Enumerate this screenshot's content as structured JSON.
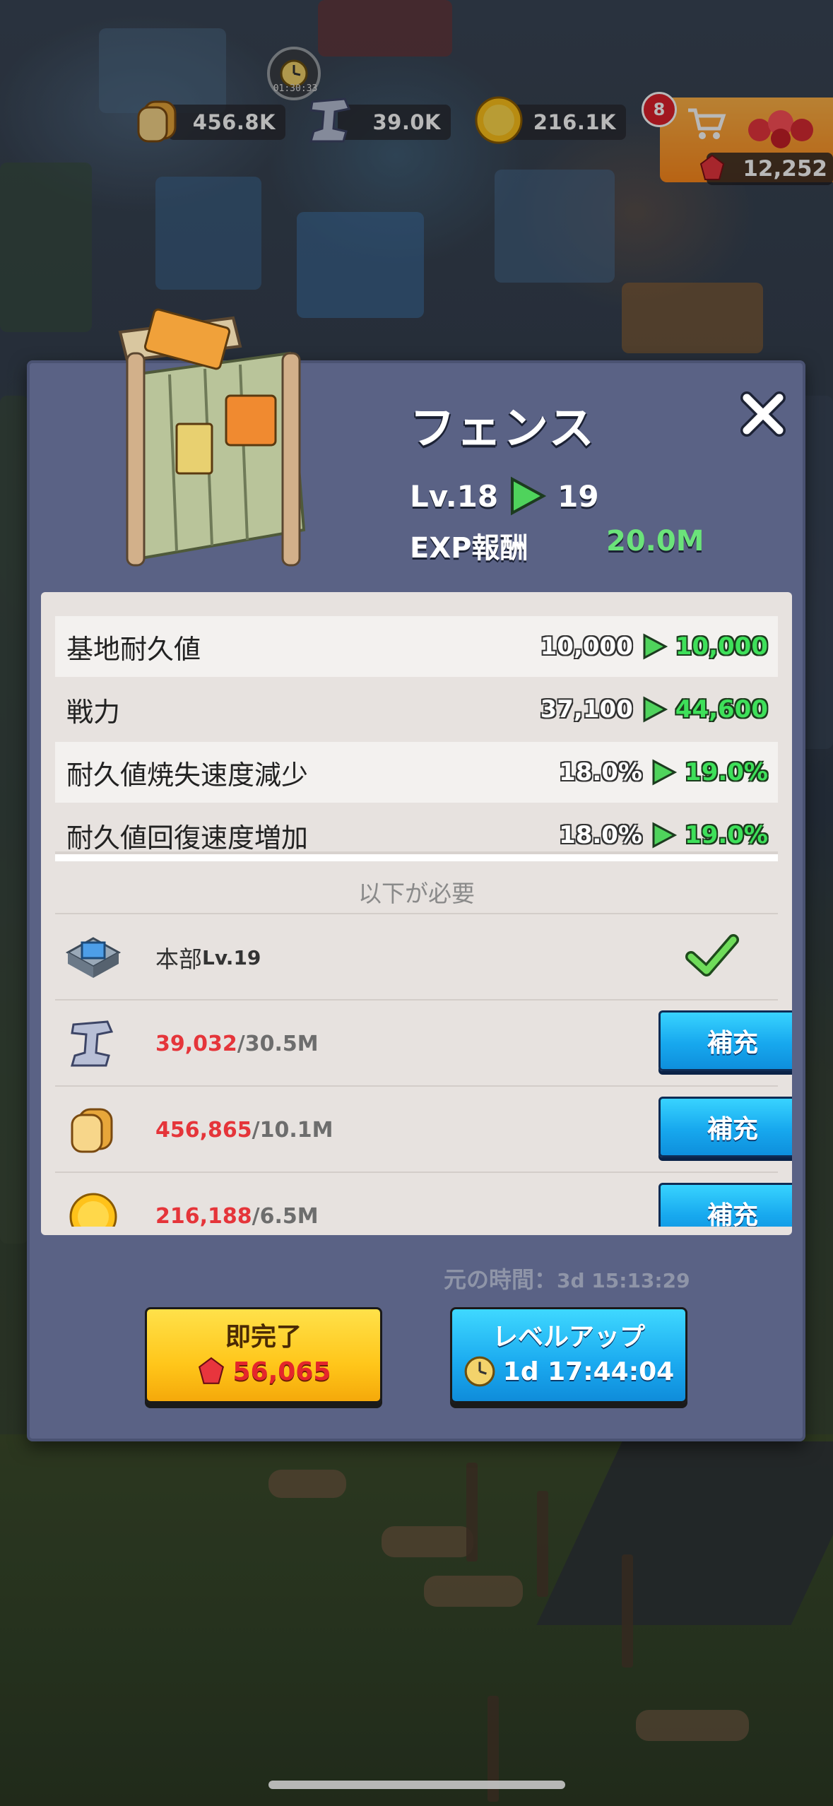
{
  "resources": {
    "food": "456.8K",
    "iron": "39.0K",
    "gold": "216.1K"
  },
  "timer_label": "01:30:33",
  "shop": {
    "badge": "8",
    "gems": "12,252"
  },
  "modal": {
    "title": "フェンス",
    "level_prefix": "Lv.18",
    "level_next": "19",
    "exp_label": "EXP報酬",
    "exp_value": "20.0M",
    "stats": [
      {
        "label": "基地耐久値",
        "old": "10,000",
        "new": "10,000"
      },
      {
        "label": "戦力",
        "old": "37,100",
        "new": "44,600"
      },
      {
        "label": "耐久値焼失速度減少",
        "old": "18.0%",
        "new": "19.0%"
      },
      {
        "label": "耐久値回復速度増加",
        "old": "18.0%",
        "new": "19.0%"
      }
    ],
    "requirements_title": "以下が必要",
    "requirements": [
      {
        "label": "本部",
        "level": "Lv.19"
      },
      {
        "have": "39,032",
        "need": "/30.5M",
        "button": "補充"
      },
      {
        "have": "456,865",
        "need": "/10.1M",
        "button": "補充"
      },
      {
        "have": "216,188",
        "need": "/6.5M",
        "button": "補充"
      }
    ],
    "original_time_label": "元の時間：",
    "original_time_value": "3d 15:13:29",
    "instant_label": "即完了",
    "instant_cost": "56,065",
    "levelup_label": "レベルアップ",
    "levelup_time": "1d 17:44:04"
  },
  "colors": {
    "modal_bg": "#5a6285",
    "accent_green": "#3ee05a",
    "shortfall_red": "#e5353a",
    "button_blue": "#17a8ee",
    "button_yellow": "#ffc61a"
  }
}
